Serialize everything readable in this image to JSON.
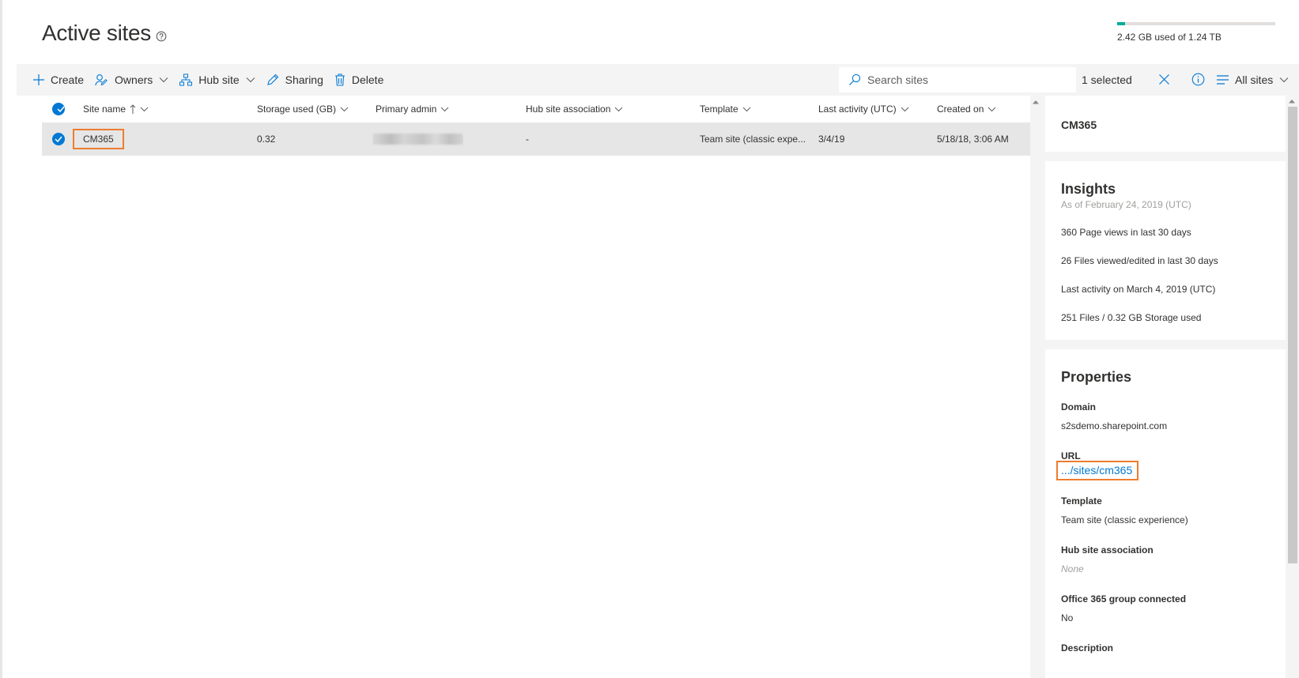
{
  "header": {
    "title": "Active sites",
    "storage": {
      "text": "2.42 GB used of 1.24 TB",
      "used_fraction": 0.05,
      "fill_color": "#00ad9a"
    }
  },
  "toolbar": {
    "create": "Create",
    "owners": "Owners",
    "hub_site": "Hub site",
    "sharing": "Sharing",
    "delete": "Delete",
    "search_placeholder": "Search sites",
    "selected": "1 selected",
    "view": "All sites"
  },
  "table": {
    "columns": [
      {
        "key": "site_name",
        "label": "Site name"
      },
      {
        "key": "storage",
        "label": "Storage used (GB)"
      },
      {
        "key": "admin",
        "label": "Primary admin"
      },
      {
        "key": "hub",
        "label": "Hub site association"
      },
      {
        "key": "template",
        "label": "Template"
      },
      {
        "key": "activity",
        "label": "Last activity (UTC)"
      },
      {
        "key": "created",
        "label": "Created on"
      }
    ],
    "rows": [
      {
        "site_name": "CM365",
        "storage": "0.32",
        "hub": "-",
        "template": "Team site (classic expe...",
        "activity": "3/4/19",
        "created": "5/18/18, 3:06 AM"
      }
    ]
  },
  "panel": {
    "site_name": "CM365",
    "insights": {
      "title": "Insights",
      "as_of": "As of February 24, 2019 (UTC)",
      "items": [
        "360 Page views in last 30 days",
        "26 Files viewed/edited in last 30 days",
        "Last activity on March 4, 2019 (UTC)",
        "251 Files / 0.32 GB Storage used"
      ]
    },
    "properties": {
      "title": "Properties",
      "domain_label": "Domain",
      "domain": "s2sdemo.sharepoint.com",
      "url_label": "URL",
      "url": ".../sites/cm365",
      "template_label": "Template",
      "template": "Team site (classic experience)",
      "hub_label": "Hub site association",
      "hub": "None",
      "group_label": "Office 365 group connected",
      "group": "No",
      "description_label": "Description"
    }
  },
  "colors": {
    "accent": "#0078d4",
    "highlight": "#ed7d31",
    "selected_row": "#e6e6e6"
  }
}
